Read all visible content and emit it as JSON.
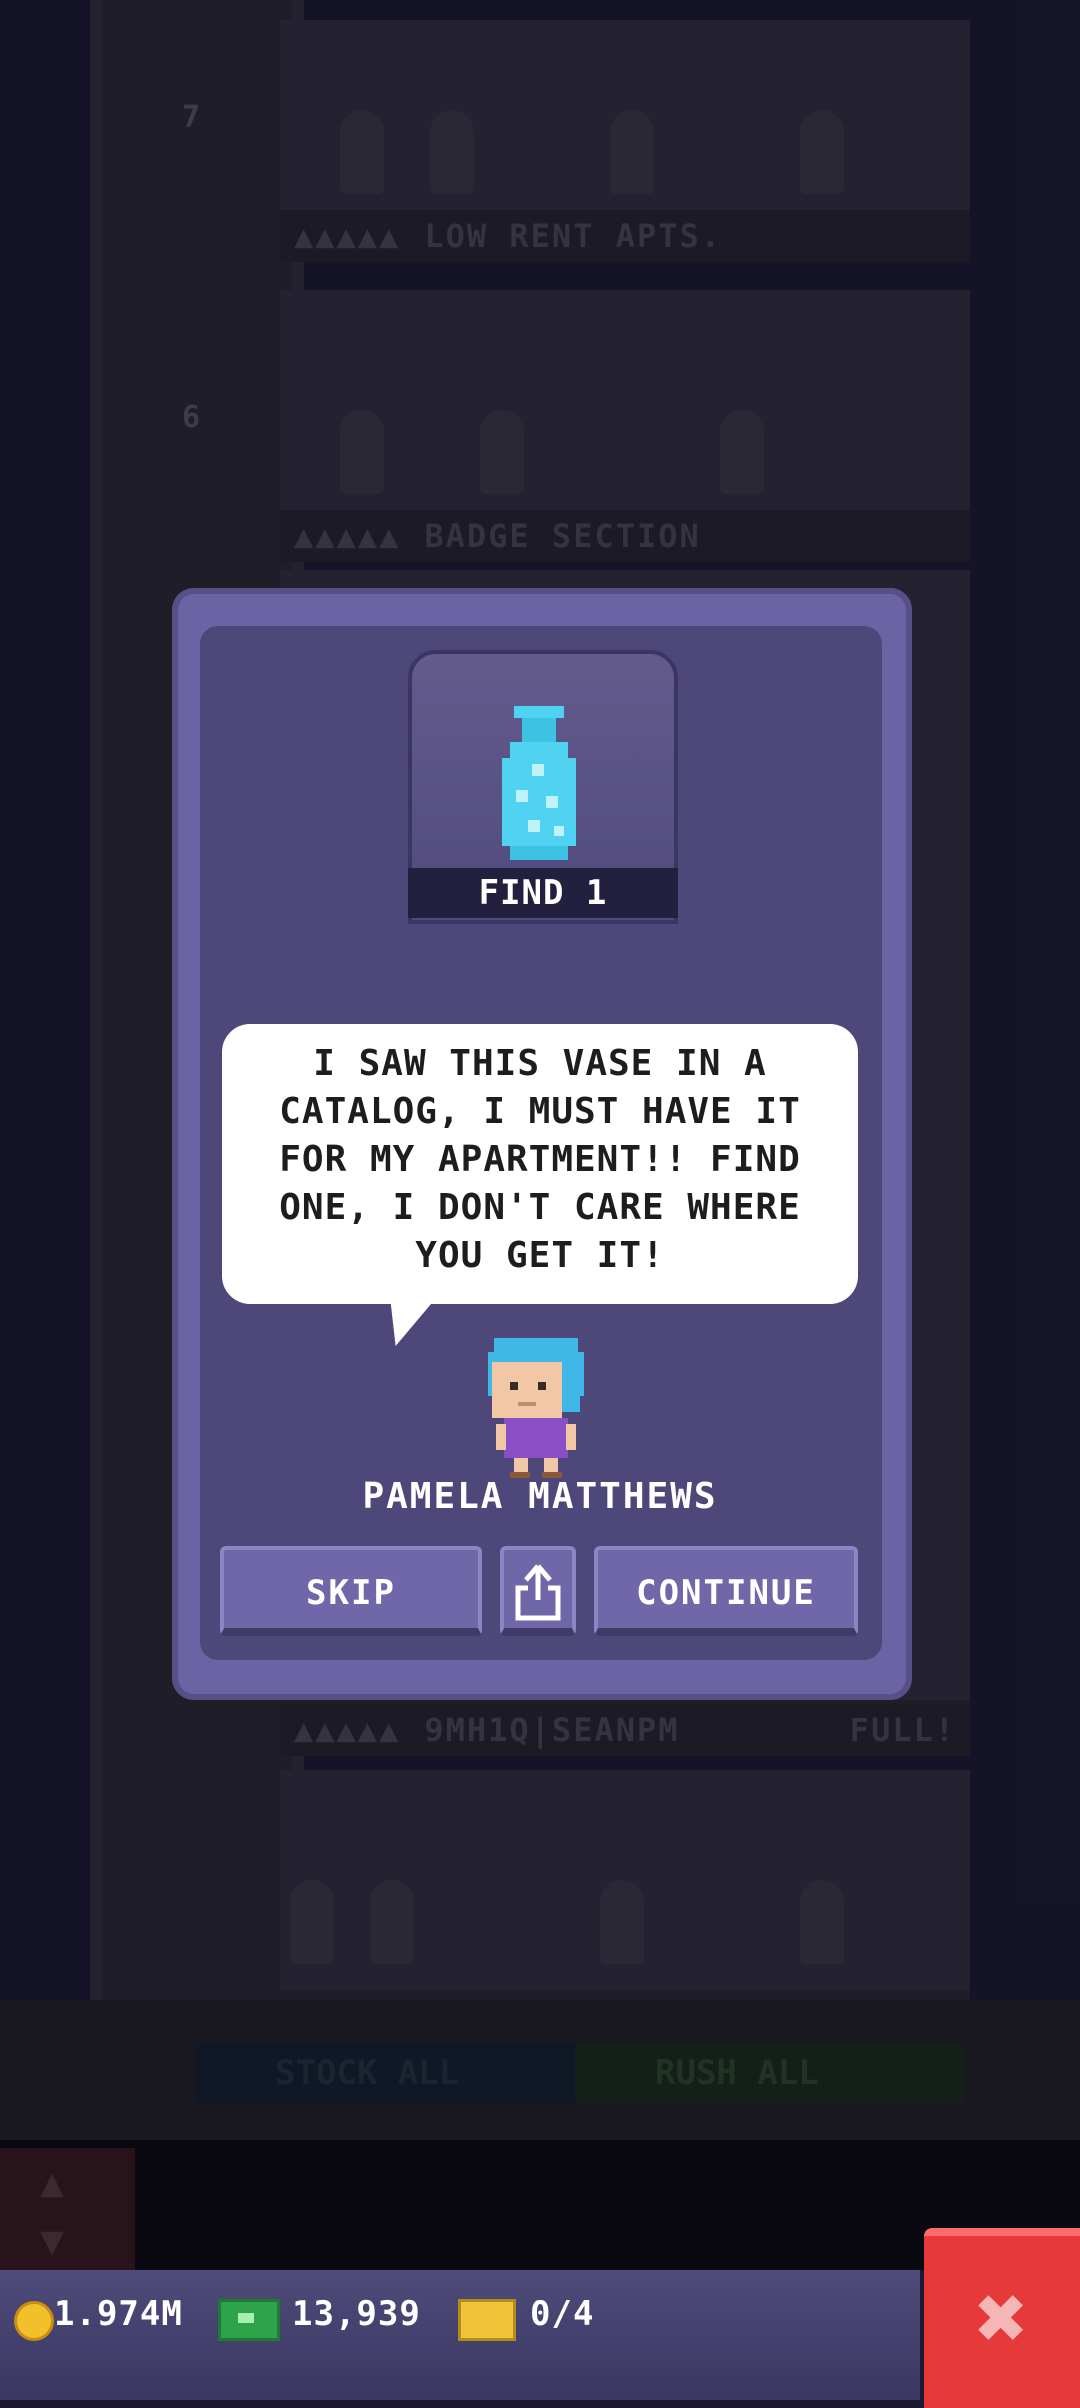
{
  "background": {
    "floors": [
      {
        "label": "LOW RENT APTS.",
        "dots": "▲▲▲▲▲",
        "number": "7"
      },
      {
        "label": "BADGE SECTION",
        "dots": "▲▲▲▲▲",
        "number": "6"
      },
      {
        "label": "9MH1Q|SEANPM",
        "dots": "▲▲▲▲▲",
        "status": "FULL!"
      }
    ],
    "buttons": {
      "stock_all": "STOCK ALL",
      "rush_all": "RUSH ALL"
    }
  },
  "dialog": {
    "item": {
      "icon": "vase-icon",
      "find_label": "FIND 1"
    },
    "message": "I SAW THIS VASE IN A CATALOG, I MUST HAVE IT FOR MY APARTMENT!! FIND ONE, I DON'T CARE WHERE YOU GET IT!",
    "npc_name": "PAMELA MATTHEWS",
    "buttons": {
      "skip": "SKIP",
      "continue": "CONTINUE"
    }
  },
  "status_bar": {
    "coins": "1.974M",
    "bux": "13,939",
    "tickets": "0/4"
  },
  "colors": {
    "dialog_outer": "#6b63a3",
    "dialog_inner": "#4d4879",
    "close_button": "#e63a3a",
    "vase": "#4fd3f0"
  }
}
